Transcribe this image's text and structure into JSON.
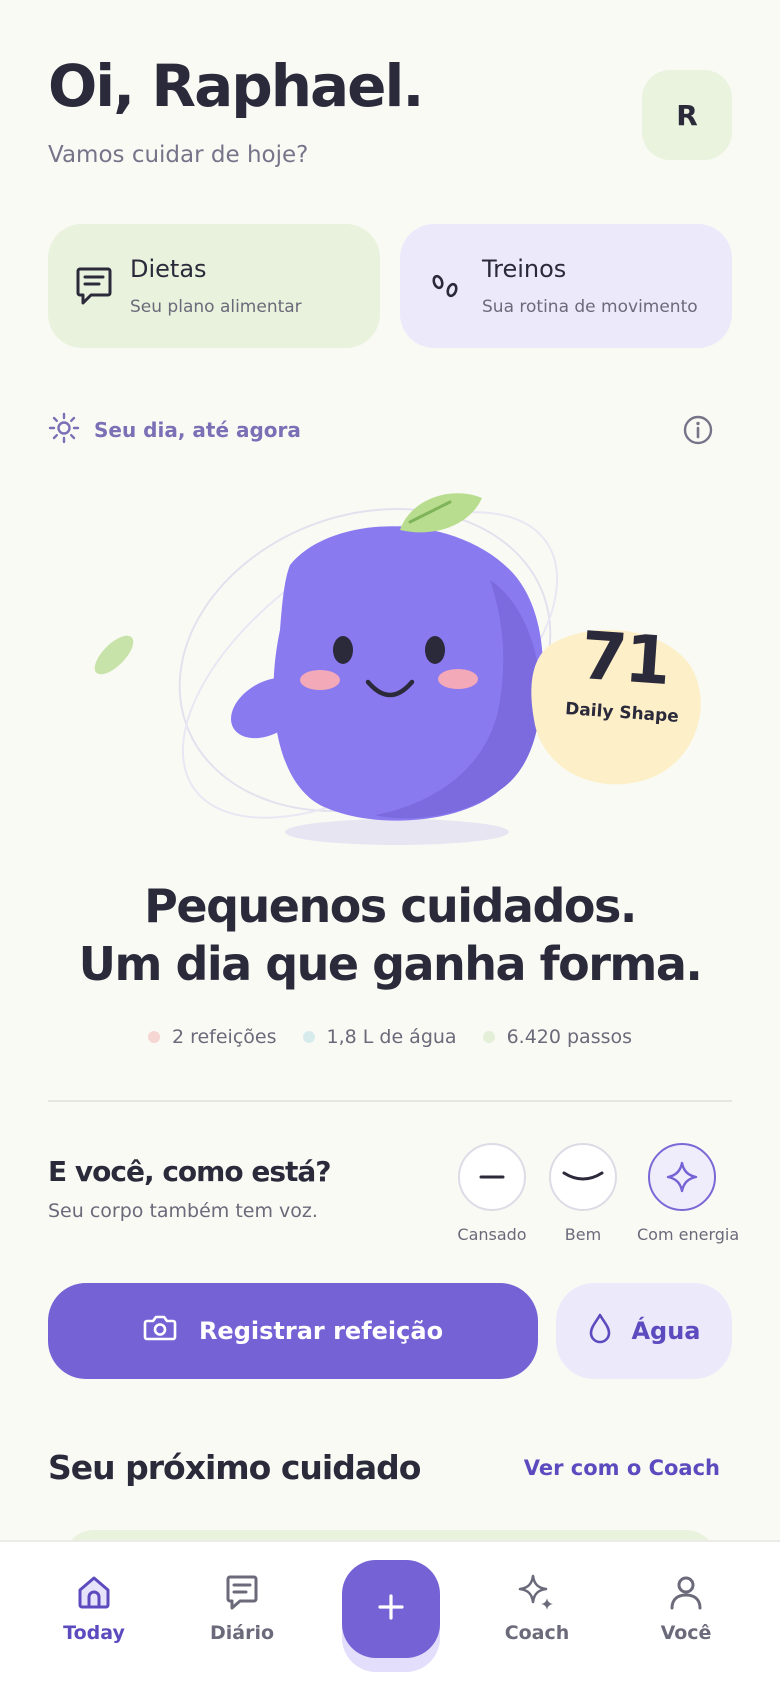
{
  "header": {
    "greeting": "Oi, Raphael.",
    "subtitle": "Vamos cuidar de hoje?",
    "avatar_initial": "R"
  },
  "quick_cards": [
    {
      "title": "Dietas",
      "subtitle": "Seu plano alimentar",
      "icon": "notepad-icon",
      "color": "#e8f2dc"
    },
    {
      "title": "Treinos",
      "subtitle": "Sua rotina de movimento",
      "icon": "footsteps-icon",
      "color": "#ece9fb"
    }
  ],
  "day_section": {
    "label": "Seu dia, até agora",
    "icon": "sun-icon",
    "info_icon": "info-icon"
  },
  "daily_shape": {
    "score": "71",
    "label": "Daily Shape"
  },
  "headline": {
    "line1": "Pequenos cuidados.",
    "line2": "Um dia que ganha forma."
  },
  "stats": [
    {
      "text": "2 refeições",
      "color": "#f6d6d3"
    },
    {
      "text": "1,8 L de água",
      "color": "#d6ecec"
    },
    {
      "text": "6.420 passos",
      "color": "#e3efd6"
    }
  ],
  "mood": {
    "title": "E você, como está?",
    "subtitle": "Seu corpo também tem voz.",
    "options": [
      {
        "label": "Cansado",
        "icon": "tired-face-icon"
      },
      {
        "label": "Bem",
        "icon": "smile-face-icon"
      },
      {
        "label": "Com energia",
        "icon": "sparkle-icon",
        "selected": true
      }
    ]
  },
  "actions": {
    "meal_label": "Registrar refeição",
    "water_label": "Água"
  },
  "next": {
    "title": "Seu próximo cuidado",
    "link": "Ver com o Coach"
  },
  "tabs": [
    {
      "label": "Today",
      "icon": "home-icon",
      "active": true
    },
    {
      "label": "Diário",
      "icon": "journal-icon"
    },
    {
      "label": "",
      "icon": "plus-icon"
    },
    {
      "label": "Coach",
      "icon": "sparkles-icon"
    },
    {
      "label": "Você",
      "icon": "user-icon"
    }
  ],
  "colors": {
    "accent": "#7563d6",
    "accent_text": "#5c4bbf",
    "mascot": "#8a7af0",
    "score_bg": "#fdf0c8",
    "leaf": "#b9dd8e"
  }
}
